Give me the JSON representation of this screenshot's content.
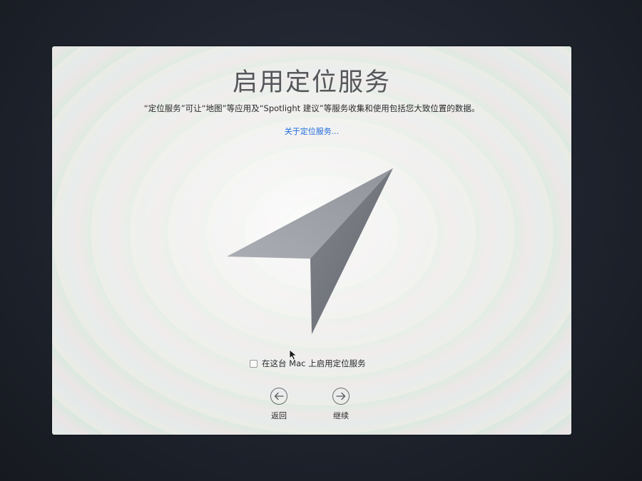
{
  "window": {
    "title": "启用定位服务",
    "description": "“定位服务”可让“地图”等应用及“Spotlight 建议”等服务收集和使用包括您大致位置的数据。",
    "learn_more_link": "关于定位服务..."
  },
  "hero": {
    "icon": "location-arrow-icon"
  },
  "options": {
    "enable_location_label": "在这台 Mac 上启用定位服务",
    "enable_location_checked": false
  },
  "navigation": {
    "back_label": "返回",
    "back_icon": "arrow-left-circle-icon",
    "continue_label": "继续",
    "continue_icon": "arrow-right-circle-icon"
  },
  "colors": {
    "link": "#1e6bdb",
    "title": "#55575b",
    "arrow_dark": "#5e6168",
    "arrow_light": "#8d9097"
  }
}
